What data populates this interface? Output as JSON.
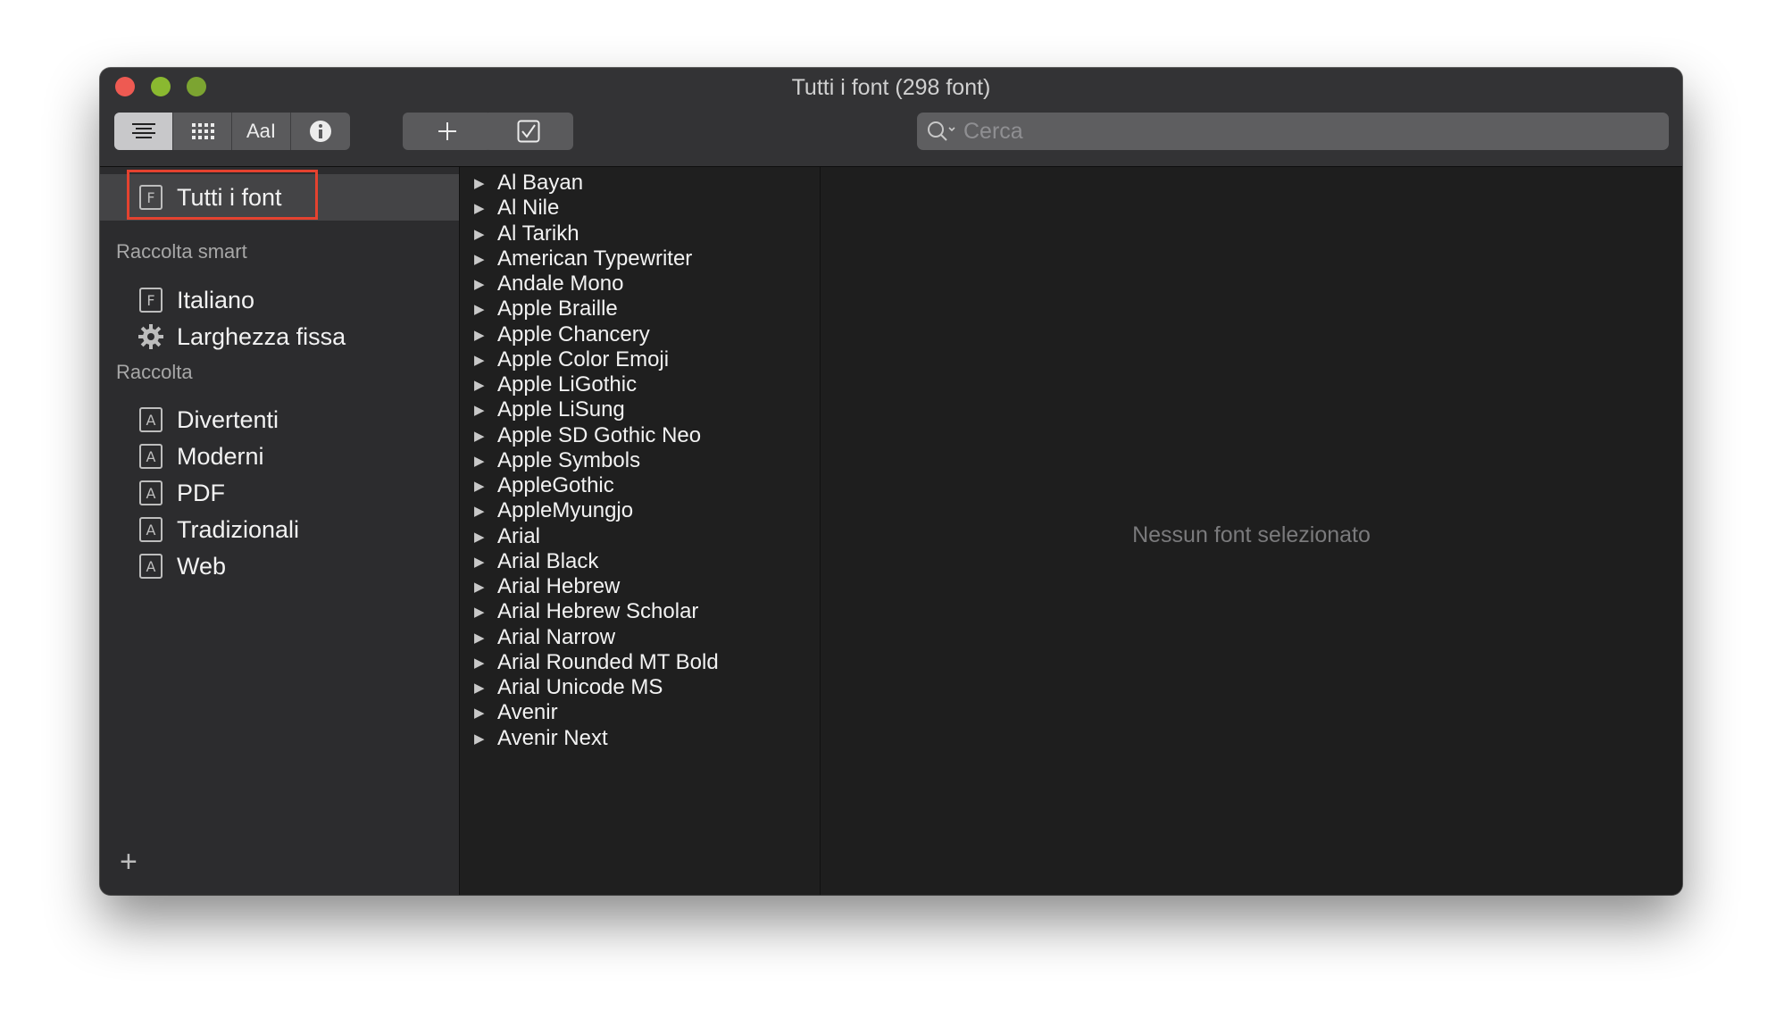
{
  "window": {
    "title": "Tutti i font (298 font)"
  },
  "toolbar": {
    "view_text_label": "AaI",
    "search_placeholder": "Cerca"
  },
  "sidebar": {
    "all_fonts": "Tutti i font",
    "smart_header": "Raccolta smart",
    "smart_items": [
      "Italiano",
      "Larghezza fissa"
    ],
    "collection_header": "Raccolta",
    "collection_items": [
      "Divertenti",
      "Moderni",
      "PDF",
      "Tradizionali",
      "Web"
    ],
    "add_label": "+"
  },
  "font_list": [
    "Al Bayan",
    "Al Nile",
    "Al Tarikh",
    "American Typewriter",
    "Andale Mono",
    "Apple Braille",
    "Apple Chancery",
    "Apple Color Emoji",
    "Apple LiGothic",
    "Apple LiSung",
    "Apple SD Gothic Neo",
    "Apple Symbols",
    "AppleGothic",
    "AppleMyungjo",
    "Arial",
    "Arial Black",
    "Arial Hebrew",
    "Arial Hebrew Scholar",
    "Arial Narrow",
    "Arial Rounded MT Bold",
    "Arial Unicode MS",
    "Avenir",
    "Avenir Next"
  ],
  "preview": {
    "empty_text": "Nessun font selezionato"
  },
  "icons": {
    "box_f_glyph": "F",
    "box_a_glyph": "A"
  },
  "colors": {
    "highlight_red": "#e4422f",
    "close": "#ee5a52",
    "minimize": "#8ab930"
  }
}
